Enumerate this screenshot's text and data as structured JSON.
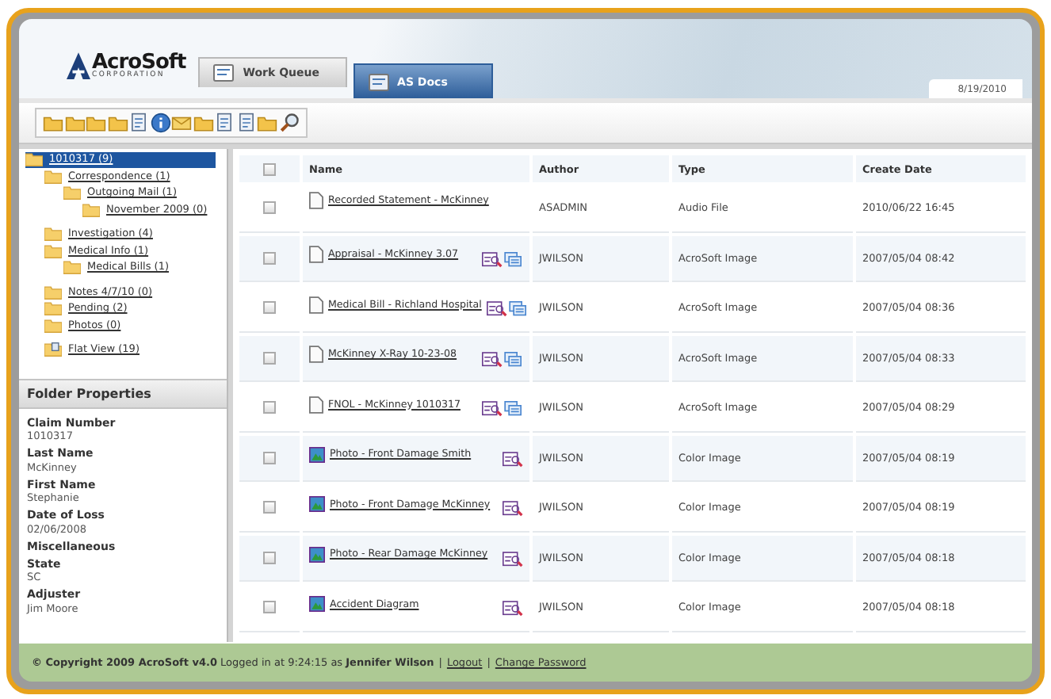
{
  "header": {
    "logo": {
      "name": "AcroSoft",
      "tagline": "CORPORATION"
    },
    "tabs": [
      {
        "label": "Work Queue",
        "selected": false
      },
      {
        "label": "AS Docs",
        "selected": true
      }
    ],
    "date": "8/19/2010"
  },
  "tree": [
    {
      "label": "1010317 (9)",
      "selected": true,
      "children": [
        {
          "label": "Correspondence (1)",
          "selected": false,
          "children": [
            {
              "label": "Outgoing Mail (1)",
              "selected": false,
              "children": [
                {
                  "label": "November 2009 (0)",
                  "selected": false
                }
              ]
            }
          ]
        },
        {
          "label": "Investigation (4)",
          "selected": false
        },
        {
          "label": "Medical Info (1)",
          "selected": false,
          "children": [
            {
              "label": "Medical Bills (1)",
              "selected": false
            }
          ]
        },
        {
          "label": "Notes 4/7/10 (0)",
          "selected": false
        },
        {
          "label": "Pending (2)",
          "selected": false
        },
        {
          "label": "Photos (0)",
          "selected": false
        }
      ]
    }
  ],
  "flat_view": {
    "label": "Flat View (19)"
  },
  "folder_properties": {
    "title": "Folder Properties",
    "fields": [
      {
        "label": "Claim Number",
        "value": "1010317"
      },
      {
        "label": "Last Name",
        "value": "McKinney"
      },
      {
        "label": "First Name",
        "value": "Stephanie"
      },
      {
        "label": "Date of Loss",
        "value": "02/06/2008"
      },
      {
        "label": "Miscellaneous"
      },
      {
        "label": "State",
        "value": "SC"
      },
      {
        "label": "Adjuster",
        "value": "Jim Moore"
      }
    ]
  },
  "table": {
    "select_all": {
      "checked": false
    },
    "columns": [
      "Name",
      "Author",
      "Type",
      "Create Date"
    ],
    "rows": [
      {
        "kind": "document",
        "name": "Recorded Statement - McKinney",
        "author": "ASADMIN",
        "type": "Audio File",
        "date": "2010/06/22 16:45",
        "checked": false,
        "viewable": false,
        "copyable": false
      },
      {
        "kind": "document",
        "name": "Appraisal - McKinney 3.07",
        "author": "JWILSON",
        "type": "AcroSoft Image",
        "date": "2007/05/04 08:42",
        "checked": false,
        "viewable": true,
        "copyable": true
      },
      {
        "kind": "document",
        "name": "Medical Bill - Richland Hospital",
        "author": "JWILSON",
        "type": "AcroSoft Image",
        "date": "2007/05/04 08:36",
        "checked": false,
        "viewable": true,
        "copyable": true
      },
      {
        "kind": "document",
        "name": "McKinney X-Ray 10-23-08",
        "author": "JWILSON",
        "type": "AcroSoft Image",
        "date": "2007/05/04 08:33",
        "checked": false,
        "viewable": true,
        "copyable": true
      },
      {
        "kind": "document",
        "name": "FNOL - McKinney 1010317",
        "author": "JWILSON",
        "type": "AcroSoft Image",
        "date": "2007/05/04 08:29",
        "checked": false,
        "viewable": true,
        "copyable": true
      },
      {
        "kind": "image",
        "name": "Photo - Front Damage Smith",
        "author": "JWILSON",
        "type": "Color Image",
        "date": "2007/05/04 08:19",
        "checked": false,
        "viewable": true,
        "copyable": false
      },
      {
        "kind": "image",
        "name": "Photo - Front Damage McKinney",
        "author": "JWILSON",
        "type": "Color Image",
        "date": "2007/05/04 08:19",
        "checked": false,
        "viewable": true,
        "copyable": false
      },
      {
        "kind": "image",
        "name": "Photo - Rear Damage McKinney",
        "author": "JWILSON",
        "type": "Color Image",
        "date": "2007/05/04 08:18",
        "checked": false,
        "viewable": true,
        "copyable": false
      },
      {
        "kind": "image",
        "name": "Accident Diagram",
        "author": "JWILSON",
        "type": "Color Image",
        "date": "2007/05/04 08:18",
        "checked": false,
        "viewable": true,
        "copyable": false
      }
    ]
  },
  "footer": {
    "text": "**© Copyright 2009 AcroSoft v4.0** Logged in at 9:24:15 as **Jennifer Wilson**",
    "separator": "|",
    "links": [
      "Logout",
      "Change Password"
    ]
  }
}
